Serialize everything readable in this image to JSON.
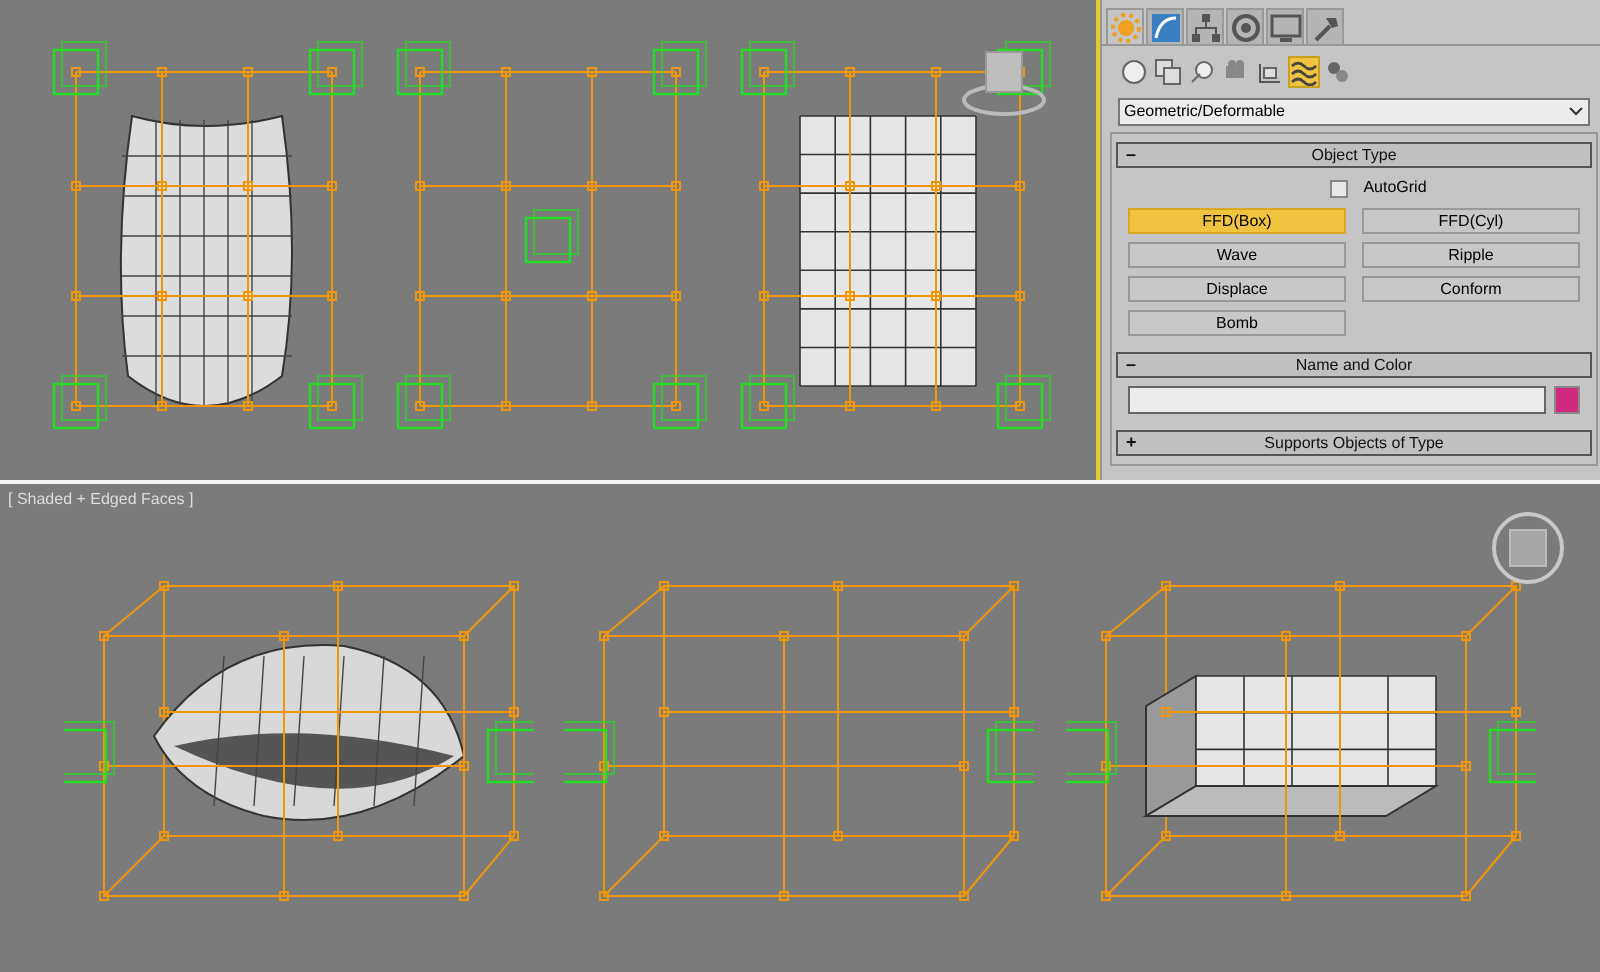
{
  "command_panel": {
    "tabs": [
      {
        "selected": true
      },
      {
        "selected": false
      },
      {
        "selected": false
      },
      {
        "selected": false
      },
      {
        "selected": false
      },
      {
        "selected": false
      }
    ],
    "categories": [
      {
        "selected": false
      },
      {
        "selected": false
      },
      {
        "selected": false
      },
      {
        "selected": false
      },
      {
        "selected": false
      },
      {
        "selected": true
      },
      {
        "selected": false
      }
    ],
    "dropdown": {
      "value": "Geometric/Deformable"
    },
    "rollouts": [
      {
        "kind": "object_type",
        "toggle": "–",
        "title": "Object Type",
        "expanded": true,
        "autogrid": {
          "label": "AutoGrid",
          "checked": false
        },
        "buttons": [
          {
            "label": "FFD(Box)",
            "selected": true
          },
          {
            "label": "FFD(Cyl)",
            "selected": false
          },
          {
            "label": "Wave",
            "selected": false
          },
          {
            "label": "Ripple",
            "selected": false
          },
          {
            "label": "Displace",
            "selected": false
          },
          {
            "label": "Conform",
            "selected": false
          },
          {
            "label": "Bomb",
            "selected": false
          }
        ]
      },
      {
        "kind": "name_color",
        "toggle": "–",
        "title": "Name and Color",
        "expanded": true
      },
      {
        "kind": "supports",
        "toggle": "+",
        "title": "Supports Objects of Type",
        "expanded": false
      }
    ]
  },
  "bottom_viewport": {
    "label": "[ Shaded + Edged Faces ]"
  }
}
